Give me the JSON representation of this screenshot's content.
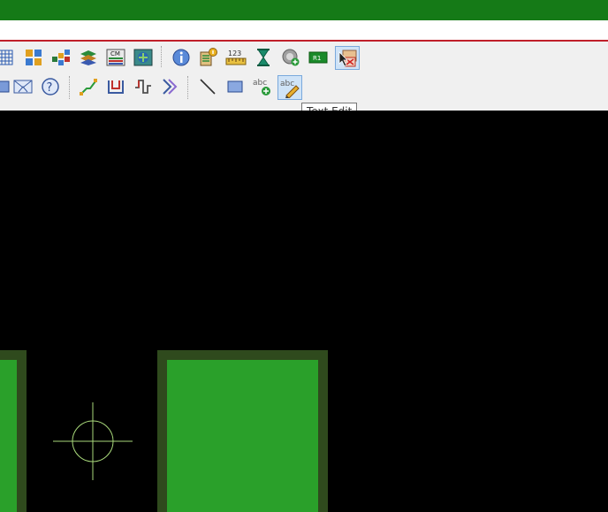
{
  "window": {
    "title_bar_color": "#157a17",
    "accent_line_color": "#c0202a"
  },
  "toolbar_row1": {
    "icons": [
      "grid-icon",
      "component-placement-icon",
      "array-placement-icon",
      "layer-stack-icon",
      "cm-manager-icon",
      "board-view-icon",
      "info-icon",
      "property-info-icon",
      "measure-ruler-icon",
      "hourglass-icon",
      "add-via-icon",
      "reference-designator-icon",
      "select-cursor-icon"
    ]
  },
  "toolbar_row2": {
    "icons": [
      "route-icon",
      "envelope-icon",
      "help-icon",
      "diagonal-route-icon",
      "net-tune-icon",
      "trace-meander-icon",
      "fanout-icon",
      "draw-line-icon",
      "draw-rectangle-icon",
      "add-text-icon",
      "text-edit-icon"
    ]
  },
  "tooltip": {
    "text": "Text Edit"
  },
  "canvas": {
    "background": "#000000",
    "pad_fill": "#2aa02a",
    "pad_border": "#2f4a1d",
    "crosshair_color": "#a8d87a"
  }
}
